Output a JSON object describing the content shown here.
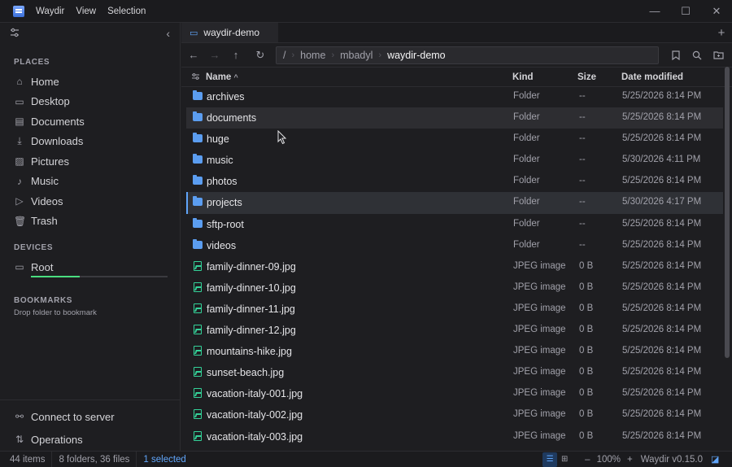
{
  "titlebar": {
    "menus": [
      "Waydir",
      "View",
      "Selection"
    ],
    "controls": [
      "—",
      "☐",
      "✕"
    ]
  },
  "sidebar": {
    "places_label": "PLACES",
    "places": [
      {
        "label": "Home",
        "icon": "home-icon"
      },
      {
        "label": "Desktop",
        "icon": "desktop-icon"
      },
      {
        "label": "Documents",
        "icon": "documents-icon"
      },
      {
        "label": "Downloads",
        "icon": "downloads-icon"
      },
      {
        "label": "Pictures",
        "icon": "pictures-icon"
      },
      {
        "label": "Music",
        "icon": "music-icon"
      },
      {
        "label": "Videos",
        "icon": "videos-icon"
      },
      {
        "label": "Trash",
        "icon": "trash-icon"
      }
    ],
    "devices_label": "DEVICES",
    "devices": [
      {
        "label": "Root",
        "usage_fraction": 0.36
      }
    ],
    "bookmarks_label": "BOOKMARKS",
    "bookmarks_hint": "Drop folder to bookmark",
    "connect_label": "Connect to server",
    "operations_label": "Operations"
  },
  "tabs": [
    {
      "label": "waydir-demo"
    }
  ],
  "path": {
    "root": "/",
    "segments": [
      "home",
      "mbadyl",
      "waydir-demo"
    ]
  },
  "columns": {
    "name": "Name",
    "kind": "Kind",
    "size": "Size",
    "date": "Date modified"
  },
  "files": [
    {
      "name": "archives",
      "kind": "Folder",
      "size": "--",
      "date": "5/25/2026 8:14 PM",
      "type": "folder"
    },
    {
      "name": "documents",
      "kind": "Folder",
      "size": "--",
      "date": "5/25/2026 8:14 PM",
      "type": "folder"
    },
    {
      "name": "huge",
      "kind": "Folder",
      "size": "--",
      "date": "5/25/2026 8:14 PM",
      "type": "folder"
    },
    {
      "name": "music",
      "kind": "Folder",
      "size": "--",
      "date": "5/30/2026 4:11 PM",
      "type": "folder"
    },
    {
      "name": "photos",
      "kind": "Folder",
      "size": "--",
      "date": "5/25/2026 8:14 PM",
      "type": "folder"
    },
    {
      "name": "projects",
      "kind": "Folder",
      "size": "--",
      "date": "5/30/2026 4:17 PM",
      "type": "folder"
    },
    {
      "name": "sftp-root",
      "kind": "Folder",
      "size": "--",
      "date": "5/25/2026 8:14 PM",
      "type": "folder"
    },
    {
      "name": "videos",
      "kind": "Folder",
      "size": "--",
      "date": "5/25/2026 8:14 PM",
      "type": "folder"
    },
    {
      "name": "family-dinner-09.jpg",
      "kind": "JPEG image",
      "size": "0 B",
      "date": "5/25/2026 8:14 PM",
      "type": "image"
    },
    {
      "name": "family-dinner-10.jpg",
      "kind": "JPEG image",
      "size": "0 B",
      "date": "5/25/2026 8:14 PM",
      "type": "image"
    },
    {
      "name": "family-dinner-11.jpg",
      "kind": "JPEG image",
      "size": "0 B",
      "date": "5/25/2026 8:14 PM",
      "type": "image"
    },
    {
      "name": "family-dinner-12.jpg",
      "kind": "JPEG image",
      "size": "0 B",
      "date": "5/25/2026 8:14 PM",
      "type": "image"
    },
    {
      "name": "mountains-hike.jpg",
      "kind": "JPEG image",
      "size": "0 B",
      "date": "5/25/2026 8:14 PM",
      "type": "image"
    },
    {
      "name": "sunset-beach.jpg",
      "kind": "JPEG image",
      "size": "0 B",
      "date": "5/25/2026 8:14 PM",
      "type": "image"
    },
    {
      "name": "vacation-italy-001.jpg",
      "kind": "JPEG image",
      "size": "0 B",
      "date": "5/25/2026 8:14 PM",
      "type": "image"
    },
    {
      "name": "vacation-italy-002.jpg",
      "kind": "JPEG image",
      "size": "0 B",
      "date": "5/25/2026 8:14 PM",
      "type": "image"
    },
    {
      "name": "vacation-italy-003.jpg",
      "kind": "JPEG image",
      "size": "0 B",
      "date": "5/25/2026 8:14 PM",
      "type": "image"
    }
  ],
  "hovered_row": 1,
  "selected_row": 5,
  "status": {
    "items": "44 items",
    "breakdown": "8 folders, 36 files",
    "selected": "1 selected",
    "zoom": "100%",
    "version": "Waydir v0.15.0"
  },
  "colors": {
    "accent": "#60a5fa",
    "folder": "#5b9df0",
    "image": "#34d399",
    "drive_usage": "#4ade80"
  }
}
